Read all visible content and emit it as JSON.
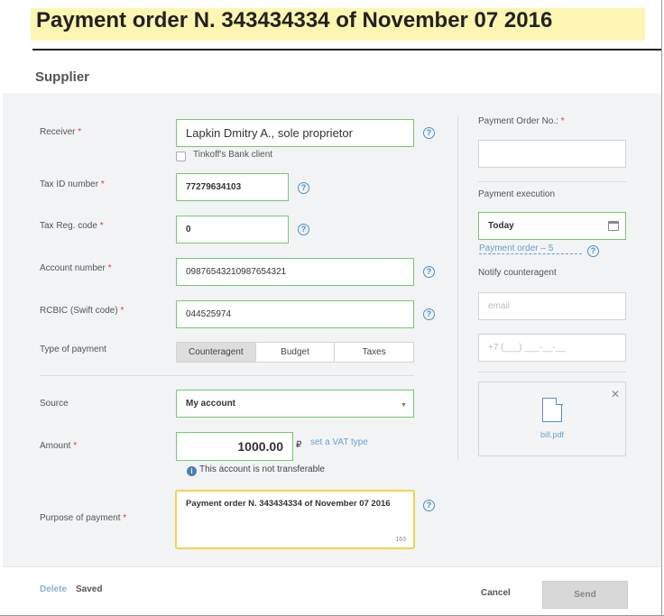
{
  "header": {
    "title": "Payment order N. 343434334 of November 07 2016",
    "section": "Supplier"
  },
  "form": {
    "receiver": {
      "label": "Receiver",
      "value": "Lapkin Dmitry A., sole proprietor"
    },
    "tinkoff_client": {
      "label": "Tinkoff's Bank client",
      "checked": false
    },
    "tax_id": {
      "label": "Tax ID number",
      "value": "77279634103"
    },
    "tax_reg": {
      "label": "Tax Reg. code",
      "value": "0"
    },
    "account": {
      "label": "Account number",
      "value": "09876543210987654321"
    },
    "rcbic": {
      "label": "RCBIC (Swift code)",
      "value": "044525974"
    },
    "payment_type": {
      "label": "Type of payment",
      "options": [
        "Counteragent",
        "Budget",
        "Taxes"
      ],
      "selected": "Counteragent"
    },
    "source": {
      "label": "Source",
      "value": "My account"
    },
    "amount": {
      "label": "Amount",
      "value": "1000.00",
      "currency": "₽",
      "vat_link": "set a VAT type"
    },
    "note": "This account is not transferable",
    "purpose": {
      "label": "Purpose of payment",
      "value": "Payment order N. 343434334 of November 07 2016",
      "counter": "163"
    }
  },
  "side": {
    "order_no": {
      "label": "Payment Order No.:",
      "value": ""
    },
    "execution": {
      "label": "Payment execution",
      "value": "Today",
      "link": "Payment order – 5"
    },
    "notify": {
      "label": "Notify counteragent",
      "email_placeholder": "email",
      "phone_placeholder": "+7 (___) ___-__-__"
    },
    "file": {
      "name": "bill.pdf"
    }
  },
  "footer": {
    "delete": "Delete",
    "saved": "Saved",
    "cancel": "Cancel",
    "send": "Send"
  },
  "icons": {
    "help": "question-circle-icon",
    "calendar": "calendar-icon",
    "info": "info-icon",
    "close": "close-icon",
    "document": "document-icon",
    "dropdown": "chevron-down-icon"
  },
  "colors": {
    "accent_green": "#74c96f",
    "title_highlight": "#fdf6b2",
    "purpose_border": "#f0d44c",
    "link_blue": "#6a9fd0",
    "required_red": "#e03a3a"
  }
}
